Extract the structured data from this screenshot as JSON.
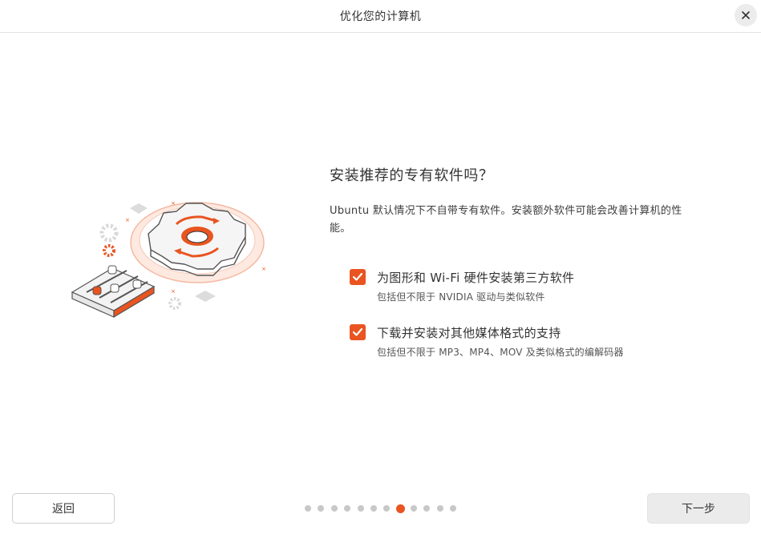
{
  "header": {
    "title": "优化您的计算机",
    "close_icon": "close-icon"
  },
  "main": {
    "question": "安装推荐的专有软件吗？",
    "description": "Ubuntu 默认情况下不自带专有软件。安装额外软件可能会改善计算机的性能。",
    "options": [
      {
        "label": "为图形和 Wi-Fi 硬件安装第三方软件",
        "sublabel": "包括但不限于 NVIDIA 驱动与类似软件",
        "checked": true
      },
      {
        "label": "下载并安装对其他媒体格式的支持",
        "sublabel": "包括但不限于 MP3、MP4、MOV 及类似格式的编解码器",
        "checked": true
      }
    ]
  },
  "footer": {
    "back_label": "返回",
    "next_label": "下一步",
    "page_count": 12,
    "current_page": 8
  },
  "colors": {
    "accent": "#e95420",
    "dot_inactive": "#c8c8c8"
  }
}
